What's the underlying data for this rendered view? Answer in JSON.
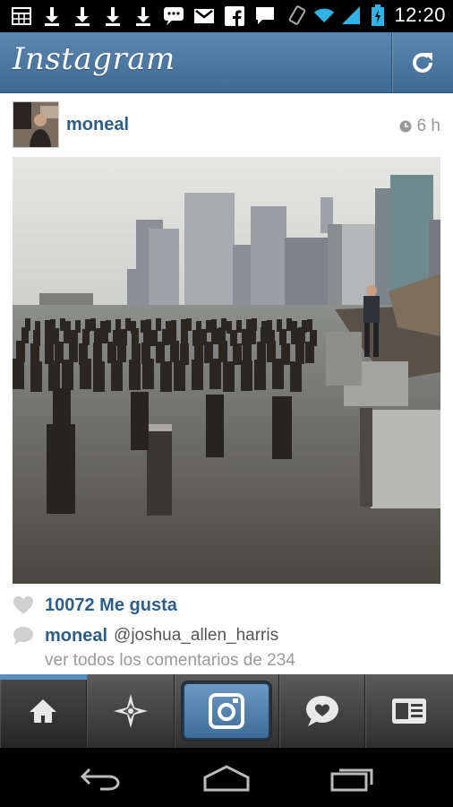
{
  "status_bar": {
    "time": "12:20",
    "notification_icons": [
      "calendar-icon",
      "download-icon",
      "download-icon",
      "download-icon",
      "download-icon",
      "chat-icon",
      "gmail-icon",
      "facebook-icon",
      "message-icon"
    ],
    "system_icons": [
      "vibrate-icon",
      "wifi-icon",
      "signal-icon",
      "battery-icon"
    ]
  },
  "header": {
    "title": "Instagram",
    "accent": "#4a78a3"
  },
  "post": {
    "username": "moneal",
    "time_ago": "6 h",
    "likes_text": "10072 Me gusta",
    "comment": {
      "user": "moneal",
      "text": "@joshua_allen_harris"
    },
    "view_all_comments": "ver todos los comentarios de 234"
  },
  "tab_bar": {
    "tabs": [
      "home-icon",
      "explore-icon",
      "camera-icon",
      "activity-icon",
      "profile-icon"
    ],
    "active_tab": "home-icon"
  },
  "nav_bar": [
    "back-icon",
    "home-icon",
    "recent-apps-icon"
  ]
}
